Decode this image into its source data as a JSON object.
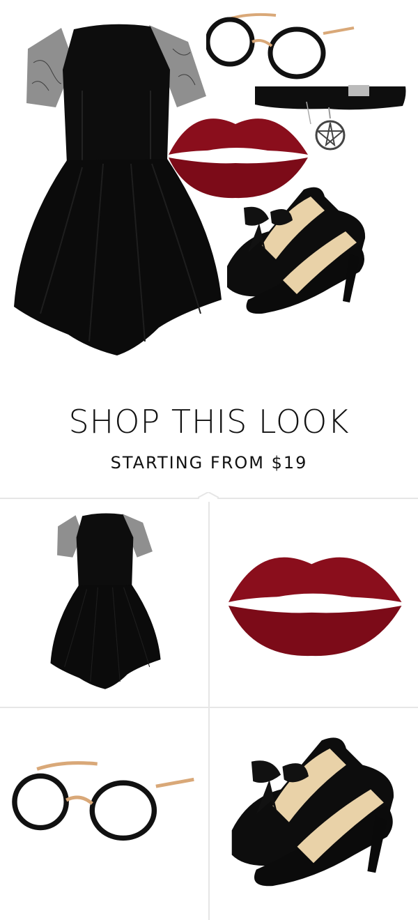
{
  "header": {
    "title": "SHOP THIS LOOK",
    "subtitle": "STARTING FROM $19"
  },
  "colors": {
    "lips": "#8a0e1c",
    "lips_dark": "#5e0712",
    "dress": "#0d0d0d",
    "lace": "#5a5a5a",
    "frame": "#111111",
    "gold": "#d9a878",
    "shoe_lining": "#e9d2a8"
  },
  "products": [
    {
      "icon": "dress-icon"
    },
    {
      "icon": "lips-icon"
    },
    {
      "icon": "glasses-icon"
    },
    {
      "icon": "heels-icon"
    }
  ],
  "collage": {
    "items": [
      "dress-icon",
      "glasses-icon",
      "choker-icon",
      "lips-icon",
      "heels-icon"
    ]
  }
}
